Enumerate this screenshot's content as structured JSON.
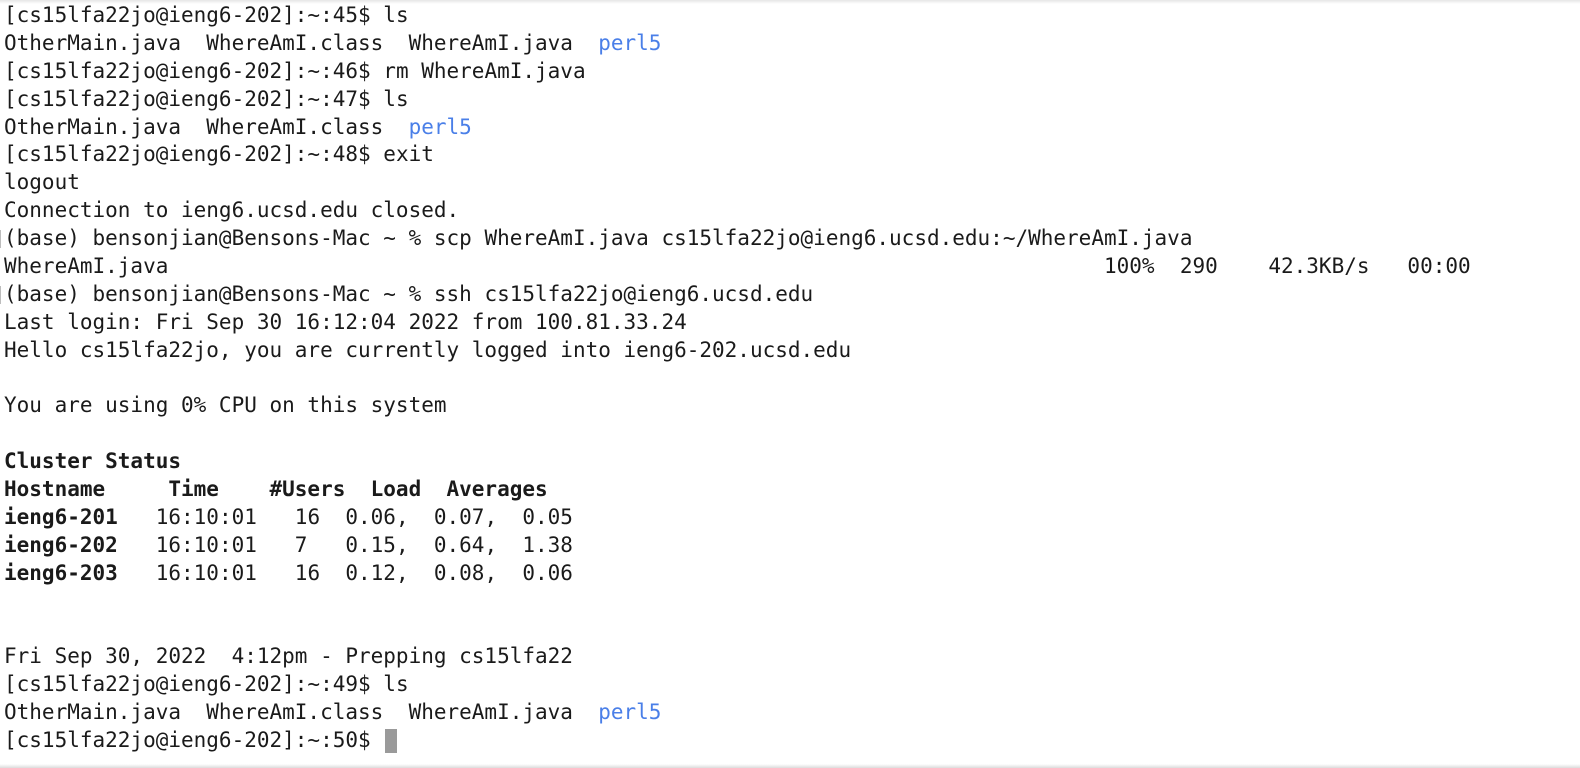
{
  "terminal": {
    "lines": {
      "l0": {
        "prompt": "[cs15lfa22jo@ieng6-202]:~:45$",
        "cmd": " ls"
      },
      "l1": {
        "files": "OtherMain.java  WhereAmI.class  WhereAmI.java  ",
        "dir": "perl5"
      },
      "l2": {
        "prompt": "[cs15lfa22jo@ieng6-202]:~:46$",
        "cmd": " rm WhereAmI.java"
      },
      "l3": {
        "prompt": "[cs15lfa22jo@ieng6-202]:~:47$",
        "cmd": " ls"
      },
      "l4": {
        "files": "OtherMain.java  WhereAmI.class  ",
        "dir": "perl5"
      },
      "l5": {
        "prompt": "[cs15lfa22jo@ieng6-202]:~:48$",
        "cmd": " exit"
      },
      "l6": {
        "text": "logout"
      },
      "l7": {
        "text": "Connection to ieng6.ucsd.edu closed."
      },
      "l8": {
        "prompt": "(base) bensonjian@Bensons-Mac ~ %",
        "cmd": " scp WhereAmI.java cs15lfa22jo@ieng6.ucsd.edu:~/WhereAmI.java"
      },
      "l9": {
        "file": "WhereAmI.java",
        "stats": "100%  290    42.3KB/s   00:00"
      },
      "l10": {
        "prompt": "(base) bensonjian@Bensons-Mac ~ %",
        "cmd": " ssh cs15lfa22jo@ieng6.ucsd.edu"
      },
      "l11": {
        "text": "Last login: Fri Sep 30 16:12:04 2022 from 100.81.33.24"
      },
      "l12": {
        "text": "Hello cs15lfa22jo, you are currently logged into ieng6-202.ucsd.edu"
      },
      "l13": {
        "text": ""
      },
      "l14": {
        "text": "You are using 0% CPU on this system"
      },
      "l15": {
        "text": ""
      },
      "l16": {
        "text": "Cluster Status"
      },
      "l17": {
        "text": "Hostname     Time    #Users  Load  Averages"
      },
      "l18": {
        "host": "ieng6-201",
        "rest": "   16:10:01   16  0.06,  0.07,  0.05"
      },
      "l19": {
        "host": "ieng6-202",
        "rest": "   16:10:01   7   0.15,  0.64,  1.38"
      },
      "l20": {
        "host": "ieng6-203",
        "rest": "   16:10:01   16  0.12,  0.08,  0.06"
      },
      "l21": {
        "text": ""
      },
      "l22": {
        "text": ""
      },
      "l23": {
        "text": "Fri Sep 30, 2022  4:12pm - Prepping cs15lfa22"
      },
      "l24": {
        "prompt": "[cs15lfa22jo@ieng6-202]:~:49$",
        "cmd": " ls"
      },
      "l25": {
        "files": "OtherMain.java  WhereAmI.class  WhereAmI.java  ",
        "dir": "perl5"
      },
      "l26": {
        "prompt": "[cs15lfa22jo@ieng6-202]:~:50$",
        "cmd": " "
      }
    },
    "colors": {
      "background": "#ffffff",
      "text": "#1a1a1a",
      "directory": "#4a7fe8",
      "cursor": "#9a9a9a"
    }
  }
}
